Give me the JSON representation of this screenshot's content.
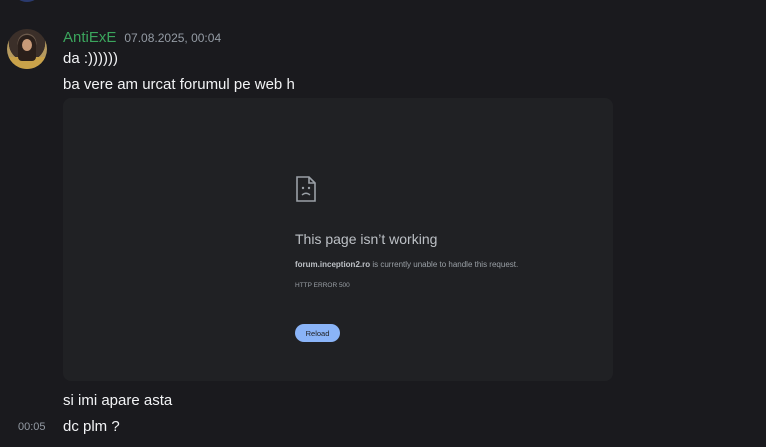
{
  "message": {
    "username": "AntiExE",
    "timestamp": "07.08.2025, 00:04",
    "lines": [
      "da :))))))",
      "ba vere am urcat forumul pe web h",
      "si imi apare asta",
      "dc plm ?"
    ],
    "last_line_time": "00:05",
    "username_color": "#3ba55d"
  },
  "attachment": {
    "icon": "sad-page-icon",
    "title": "This page isn’t working",
    "domain": "forum.inception2.ro",
    "description": " is currently unable to handle this request.",
    "error_code": "HTTP ERROR 500",
    "reload_label": "Reload",
    "accent_color": "#8ab4f8"
  }
}
